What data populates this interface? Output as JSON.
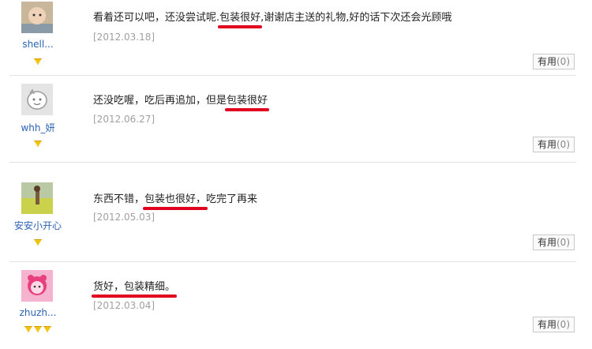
{
  "reviews": [
    {
      "username": "shell...",
      "badge_count": 1,
      "text_before": "看着还可以吧，还没尝试呢.",
      "highlight": "包装很好",
      "text_after": ",谢谢店主送的礼物,好的话下次还会光顾哦",
      "date": "[2012.03.18]",
      "useful_label": "有用",
      "useful_count": "(0)"
    },
    {
      "username": "whh_妍",
      "badge_count": 1,
      "text_before": "还没吃喔，吃后再追加，但是",
      "highlight": "包装很好",
      "text_after": "",
      "date": "[2012.06.27]",
      "useful_label": "有用",
      "useful_count": "(0)"
    },
    {
      "username": "安安小开心",
      "badge_count": 1,
      "text_before": "东西不错，",
      "highlight": "包装也很好，",
      "text_after": "吃完了再来",
      "date": "[2012.05.03]",
      "useful_label": "有用",
      "useful_count": "(0)"
    },
    {
      "username": "zhuzh...",
      "badge_count": 3,
      "text_before": "",
      "highlight": "货好，包装精细。",
      "text_after": "",
      "date": "[2012.03.04]",
      "useful_label": "有用",
      "useful_count": "(0)"
    }
  ],
  "colors": {
    "username": "#2b62b4",
    "underline": "#e1001e",
    "date": "#a0a0a0",
    "badge": "#f1c40f"
  },
  "icons": [
    "diamond-badge-icon"
  ]
}
